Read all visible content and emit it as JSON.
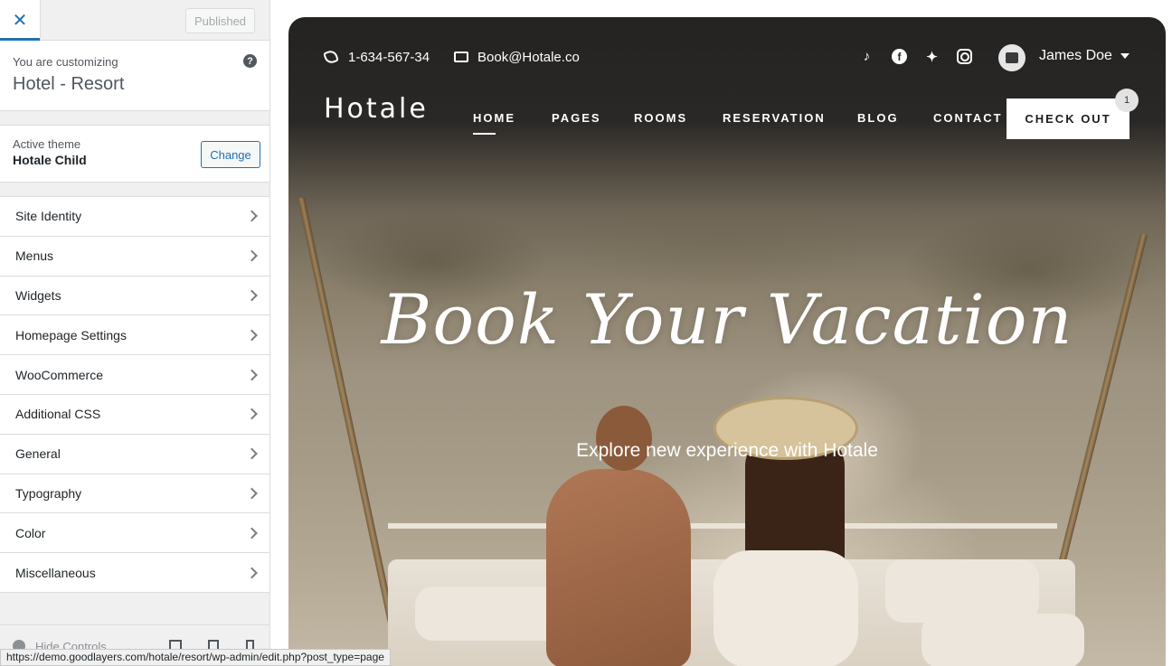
{
  "sidebar": {
    "close_icon": "close-icon",
    "publish_label": "Published",
    "customizing_label": "You are customizing",
    "site_title": "Hotel - Resort",
    "help_icon": "?",
    "theme": {
      "label": "Active theme",
      "name": "Hotale Child",
      "change_label": "Change"
    },
    "items": [
      {
        "label": "Site Identity"
      },
      {
        "label": "Menus"
      },
      {
        "label": "Widgets"
      },
      {
        "label": "Homepage Settings"
      },
      {
        "label": "WooCommerce"
      },
      {
        "label": "Additional CSS"
      },
      {
        "label": "General"
      },
      {
        "label": "Typography"
      },
      {
        "label": "Color"
      },
      {
        "label": "Miscellaneous"
      }
    ],
    "footer": {
      "hide_label": "Hide Controls"
    }
  },
  "status_bar": {
    "url": "https://demo.goodlayers.com/hotale/resort/wp-admin/edit.php?post_type=page"
  },
  "preview": {
    "topbar": {
      "phone": "1-634-567-34",
      "email": "Book@Hotale.co",
      "social_icons": [
        "tiktok-icon",
        "facebook-icon",
        "twitter-icon",
        "instagram-icon"
      ],
      "user_name": "James Doe"
    },
    "logo": "Hotale",
    "nav": {
      "home": "HOME",
      "pages": "PAGES",
      "rooms": "ROOMS",
      "reservation": "RESERVATION",
      "blog": "BLOG",
      "contact": "CONTACT",
      "checkout": "CHECK OUT",
      "cart_count": "1"
    },
    "hero": {
      "title": "Book Your Vacation",
      "subtitle": "Explore new experience with Hotale"
    }
  },
  "colors": {
    "accent": "#2271b1",
    "sidebar_bg": "#f0f0f1"
  }
}
